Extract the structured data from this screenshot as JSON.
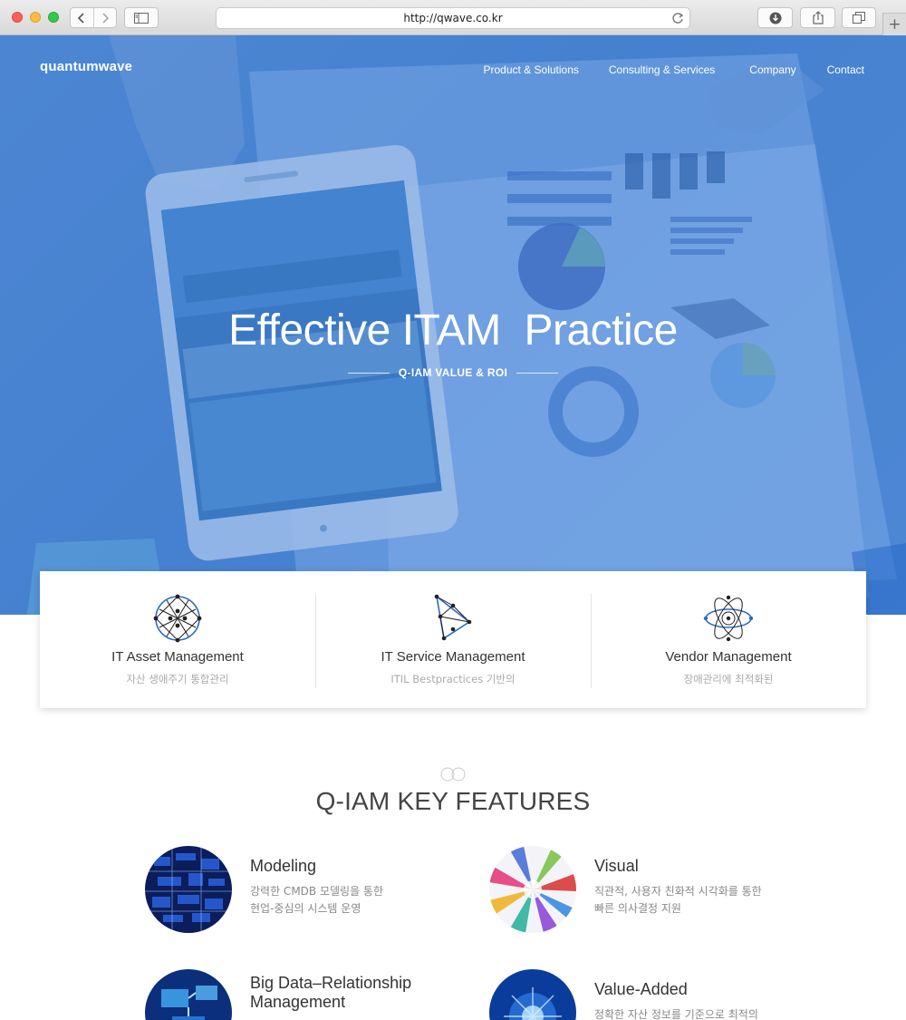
{
  "browser": {
    "url": "http://qwave.co.kr",
    "new_tab": "+"
  },
  "header": {
    "logo": "quantumwave",
    "nav": [
      {
        "label": "Product & Solutions"
      },
      {
        "label": "Consulting & Services"
      },
      {
        "label": "Company"
      },
      {
        "label": "Contact"
      }
    ]
  },
  "hero": {
    "title": "Effective ITAM  Practice",
    "subtitle": "Q-IAM VALUE & ROI"
  },
  "cards": [
    {
      "title": "IT Asset Management",
      "subtitle": "자산 생애주기 통합관리",
      "icon": "network-sphere-icon"
    },
    {
      "title": "IT Service Management",
      "subtitle": "ITIL Bestpractices 기반의",
      "icon": "triangle-network-icon"
    },
    {
      "title": "Vendor Management",
      "subtitle": "장애관리에 최적화된",
      "icon": "atom-icon"
    }
  ],
  "features": {
    "heading": "Q-IAM KEY FEATURES",
    "items": [
      {
        "name": "Modeling",
        "desc": "강력한 CMDB 모델링을 통한\n현업-중심의 시스템 운영"
      },
      {
        "name": "Visual",
        "desc": "직관적, 사용자 친화적 시각화를 통한\n빠른 의사결정 지원"
      },
      {
        "name": "Big Data–Relationship\nManagement",
        "desc": ""
      },
      {
        "name": "Value-Added",
        "desc": "정확한 자산 정보를 기준으로 최적의"
      }
    ]
  },
  "colors": {
    "hero_overlay": "#3678d7",
    "accent_blue": "#2a6bbf",
    "card_title": "#333333",
    "card_subtitle": "#aaaaaa"
  }
}
